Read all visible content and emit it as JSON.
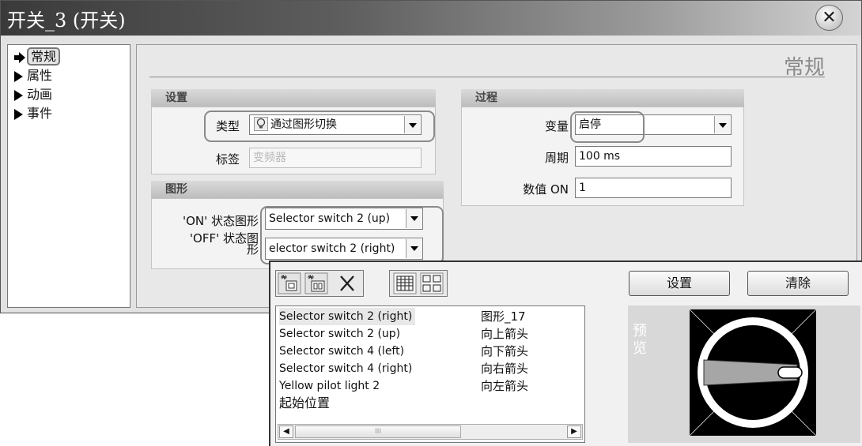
{
  "window": {
    "title": "开关_3 (开关)",
    "close_symbol": "✕"
  },
  "nav": {
    "items": [
      {
        "label": "常规",
        "selected": true
      },
      {
        "label": "属性",
        "selected": false
      },
      {
        "label": "动画",
        "selected": false
      },
      {
        "label": "事件",
        "selected": false
      }
    ]
  },
  "content": {
    "heading": "常规",
    "settings": {
      "title": "设置",
      "type_label": "类型",
      "type_value": "通过图形切换",
      "type_icon": "lightbulb-icon",
      "tag_label": "标签",
      "tag_value": "变频器"
    },
    "graphics": {
      "title": "图形",
      "on_label": "'ON' 状态图形",
      "on_value": "Selector switch 2 (up)",
      "off_label_line1": "'OFF' 状态图",
      "off_label_line2": "形",
      "off_value": "elector switch 2 (right)"
    },
    "process": {
      "title": "过程",
      "variable_label": "变量",
      "variable_value": "启停",
      "cycle_label": "周期",
      "cycle_value": "100 ms",
      "numvalue_label": "数值 ON",
      "numvalue_value": "1"
    }
  },
  "popup": {
    "set_button": "设置",
    "clear_button": "清除",
    "toolbar_icons": [
      "new-graphic-icon",
      "new-graphic-folder-icon",
      "delete-icon",
      "list-view-icon",
      "thumbnail-view-icon"
    ],
    "list_left": [
      "Selector switch 2 (right)",
      "Selector switch 2 (up)",
      "Selector switch 4 (left)",
      "Selector switch 4 (right)",
      "Yellow pilot light 2",
      "起始位置"
    ],
    "list_right": [
      "图形_17",
      "向上箭头",
      "向下箭头",
      "向右箭头",
      "向左箭头"
    ],
    "scroll_thumb_grip": "III",
    "preview_label": "预览"
  },
  "colors": {
    "titlebar_dark": "#3a3a3a",
    "panel_bg": "#e8e8e8",
    "highlight_border": "#8a8a8a"
  }
}
